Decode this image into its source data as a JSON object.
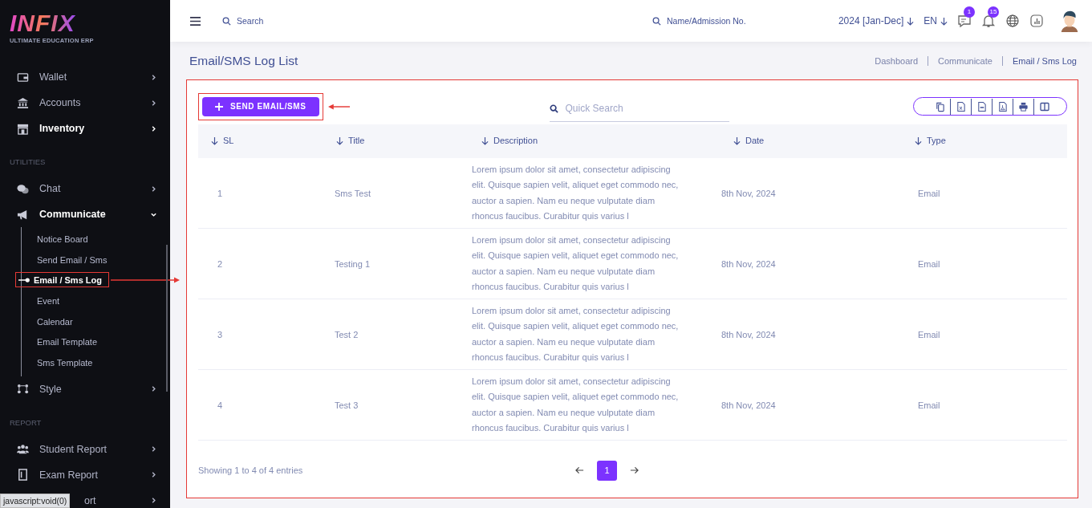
{
  "logo": {
    "name": "INFIX",
    "tagline": "ULTIMATE EDUCATION ERP"
  },
  "sidebar": {
    "items": [
      {
        "kind": "item",
        "label": "Wallet",
        "active": false,
        "expanded": false
      },
      {
        "kind": "item",
        "label": "Accounts",
        "active": false,
        "expanded": false
      },
      {
        "kind": "item",
        "label": "Inventory",
        "active": true,
        "expanded": false
      },
      {
        "kind": "heading",
        "label": "UTILITIES"
      },
      {
        "kind": "item",
        "label": "Chat",
        "active": false,
        "expanded": false
      },
      {
        "kind": "item",
        "label": "Communicate",
        "active": true,
        "expanded": true,
        "children": [
          {
            "label": "Notice Board",
            "selected": false
          },
          {
            "label": "Send Email / Sms",
            "selected": false
          },
          {
            "label": "Email / Sms Log",
            "selected": true
          },
          {
            "label": "Event",
            "selected": false
          },
          {
            "label": "Calendar",
            "selected": false
          },
          {
            "label": "Email Template",
            "selected": false
          },
          {
            "label": "Sms Template",
            "selected": false
          }
        ]
      },
      {
        "kind": "item",
        "label": "Style",
        "active": false,
        "expanded": false
      },
      {
        "kind": "heading",
        "label": "REPORT"
      },
      {
        "kind": "item",
        "label": "Student Report",
        "active": false,
        "expanded": false
      },
      {
        "kind": "item",
        "label": "Exam Report",
        "active": false,
        "expanded": false
      },
      {
        "kind": "item",
        "label": "ort",
        "active": false,
        "expanded": false
      }
    ]
  },
  "topbar": {
    "search": {
      "placeholder": "Search"
    },
    "student_search": {
      "placeholder": "Name/Admission No."
    },
    "session": "2024 [Jan-Dec]",
    "language": "EN",
    "chat_badge": "1",
    "notification_badge": "15"
  },
  "page": {
    "title": "Email/SMS Log List",
    "breadcrumbs": [
      {
        "label": "Dashboard",
        "selected": false
      },
      {
        "label": "Communicate",
        "selected": false
      },
      {
        "label": "Email / Sms Log",
        "selected": true
      }
    ]
  },
  "toolbar": {
    "send_button": "SEND EMAIL/SMS",
    "quick_search": {
      "placeholder": "Quick Search"
    }
  },
  "table": {
    "columns": [
      "SL",
      "Title",
      "Description",
      "Date",
      "Type"
    ],
    "rows": [
      [
        "1",
        "Sms Test",
        "Lorem ipsum dolor sit amet, consectetur adipiscing elit. Quisque sapien velit, aliquet eget commodo nec, auctor a sapien. Nam eu neque vulputate diam rhoncus faucibus. Curabitur quis varius l",
        "8th Nov, 2024",
        "Email"
      ],
      [
        "2",
        "Testing 1",
        "Lorem ipsum dolor sit amet, consectetur adipiscing elit. Quisque sapien velit, aliquet eget commodo nec, auctor a sapien. Nam eu neque vulputate diam rhoncus faucibus. Curabitur quis varius l",
        "8th Nov, 2024",
        "Email"
      ],
      [
        "3",
        "Test 2",
        "Lorem ipsum dolor sit amet, consectetur adipiscing elit. Quisque sapien velit, aliquet eget commodo nec, auctor a sapien. Nam eu neque vulputate diam rhoncus faucibus. Curabitur quis varius l",
        "8th Nov, 2024",
        "Email"
      ],
      [
        "4",
        "Test 3",
        "Lorem ipsum dolor sit amet, consectetur adipiscing elit. Quisque sapien velit, aliquet eget commodo nec, auctor a sapien. Nam eu neque vulputate diam rhoncus faucibus. Curabitur quis varius l",
        "8th Nov, 2024",
        "Email"
      ]
    ]
  },
  "footer": {
    "info": "Showing 1 to 4 of 4 entries",
    "pages": [
      {
        "label": "1",
        "selected": true
      }
    ]
  },
  "status_tooltip": "javascript:void(0)"
}
